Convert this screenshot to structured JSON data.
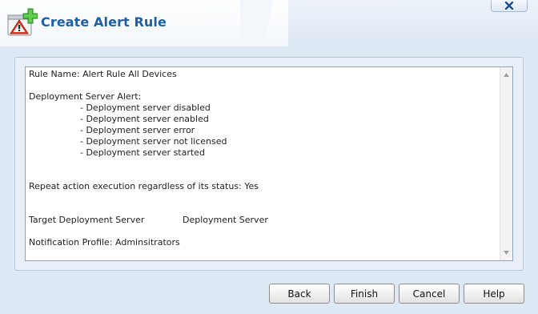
{
  "window": {
    "title": "Create Alert Rule",
    "icon": "alert-warning-add-icon",
    "close_icon": "close-icon"
  },
  "summary": {
    "rule_name": "Rule Name: Alert Rule All Devices",
    "alert_heading": "Deployment Server Alert:",
    "alert_items": [
      "- Deployment server disabled",
      "- Deployment server enabled",
      "- Deployment server error",
      "- Deployment server not licensed",
      "- Deployment server started"
    ],
    "repeat_action": "Repeat action execution regardless of its status: Yes",
    "target_label": "Target Deployment Server",
    "target_value": "Deployment Server",
    "notification_profile": "Notification Profile: Adminsitrators"
  },
  "buttons": {
    "back": "Back",
    "finish": "Finish",
    "cancel": "Cancel",
    "help": "Help"
  },
  "colors": {
    "title": "#1f5fa6",
    "background": "#dfe8f5",
    "panel_border": "#b7c7dc"
  }
}
